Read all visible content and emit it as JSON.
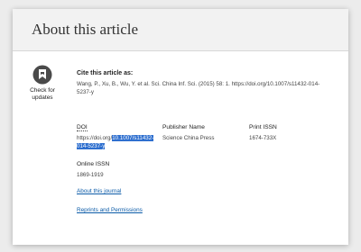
{
  "section": {
    "title": "About this article"
  },
  "updates_badge": {
    "label": "Check for updates",
    "icon": "bookmark-check-icon"
  },
  "citation": {
    "heading": "Cite this article as:",
    "text": "Wang, P., Xu, B., Wu, Y. et al. Sci. China Inf. Sci. (2015) 58: 1. https://doi.org/10.1007/s11432-014-5237-y"
  },
  "doi": {
    "label": "DOI",
    "prefix": "https://doi.org/",
    "highlighted": "10.1007/s11432-014-5237-y"
  },
  "publisher": {
    "label": "Publisher Name",
    "value": "Science China Press"
  },
  "print_issn": {
    "label": "Print ISSN",
    "value": "1674-733X"
  },
  "online_issn": {
    "label": "Online ISSN",
    "value": "1869-1919"
  },
  "links": {
    "about_journal": "About this journal",
    "reprints": "Reprints and Permissions"
  },
  "colors": {
    "link": "#0b5ba8",
    "selection": "#2e6fcf"
  }
}
